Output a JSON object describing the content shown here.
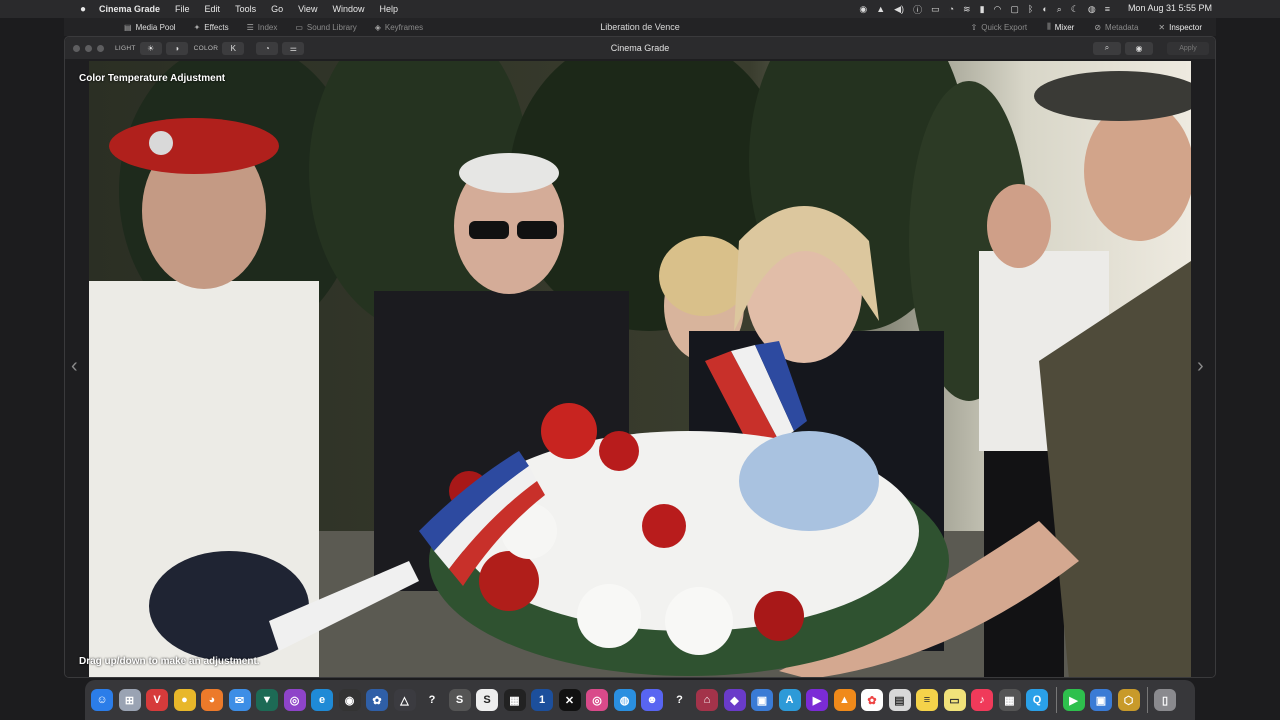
{
  "menubar": {
    "app_name": "Cinema Grade",
    "menus": [
      "File",
      "Edit",
      "Tools",
      "Go",
      "View",
      "Window",
      "Help"
    ],
    "clock": "Mon Aug 31  5:55 PM"
  },
  "fcp_toolbar": {
    "left_items": [
      "Media Pool",
      "Effects",
      "Index",
      "Sound Library",
      "Keyframes"
    ],
    "title": "Liberation de Vence",
    "right_items": [
      "Quick Export",
      "Mixer",
      "Metadata",
      "Inspector"
    ]
  },
  "window": {
    "title": "Cinema Grade",
    "light_label": "LIGHT",
    "color_label": "COLOR",
    "apply_label": "Apply"
  },
  "viewer": {
    "top_label": "Color Temperature Adjustment",
    "bottom_label": "Drag up/down to make an adjustment."
  },
  "dock": {
    "icons": [
      "finder-icon",
      "launchpad-icon",
      "vivaldi-icon",
      "chrome-icon",
      "firefox-icon",
      "mail-icon",
      "vpn-icon",
      "podcast-icon",
      "edge-icon",
      "camera-icon",
      "davinci-icon",
      "affinity-icon",
      "help-icon",
      "s-app-icon",
      "s2-app-icon",
      "pixel-icon",
      "1password-icon",
      "web-icon",
      "instagram-icon",
      "browser-icon",
      "discord-icon",
      "help2-icon",
      "tower-icon",
      "notion-icon",
      "simulator-icon",
      "testflight-icon",
      "rocket-icon",
      "vlc-icon",
      "photos-icon",
      "preview-icon",
      "notes-icon",
      "stickies-icon",
      "music-icon",
      "calculator-icon",
      "quicktime-icon",
      "facetime-icon",
      "finder2-icon",
      "app-icon",
      "trash-icon"
    ]
  }
}
